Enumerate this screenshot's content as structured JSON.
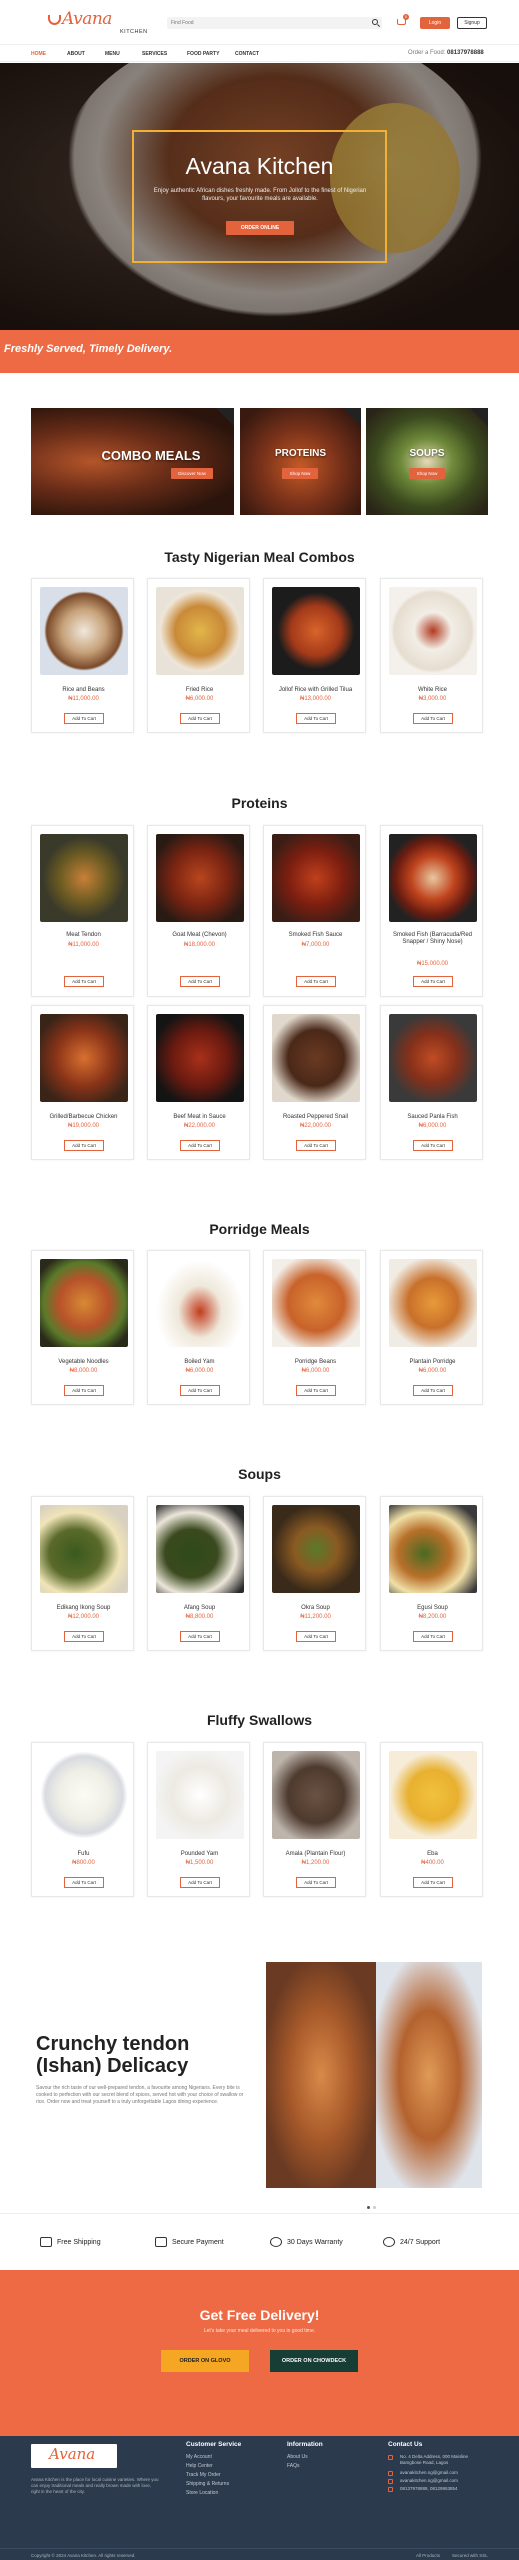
{
  "header": {
    "logo_text": "Avana",
    "logo_sub": "KITCHEN",
    "search_placeholder": "Find Food",
    "cart_count": "0",
    "login_label": "Login",
    "signup_label": "Signup"
  },
  "nav": {
    "items": [
      "HOME",
      "ABOUT",
      "MENU",
      "SERVICES",
      "FOOD PARTY",
      "CONTACT"
    ],
    "order_prefix": "Order a Food",
    "order_phone": "08137978888"
  },
  "hero": {
    "title": "Avana Kitchen",
    "tagline": "Enjoy authentic African dishes freshly made. From Jollof to the finest of Nigerian flavours, your favourite meals are available.",
    "cta": "ORDER ONLINE"
  },
  "banner": {
    "text": "Freshly Served, Timely Delivery."
  },
  "categories": [
    {
      "title": "COMBO MEALS",
      "button": "Discover Now"
    },
    {
      "title": "PROTEINS",
      "button": "Shop Now"
    },
    {
      "title": "SOUPS",
      "button": "Shop Now"
    }
  ],
  "add_to_cart_label": "Add To Cart",
  "sections": [
    {
      "title": "Tasty Nigerian Meal Combos",
      "products": [
        {
          "name": "Rice and Beans",
          "price": "₦11,000.00"
        },
        {
          "name": "Fried Rice",
          "price": "₦6,000.00"
        },
        {
          "name": "Jollof Rice with Grilled Tilua",
          "price": "₦13,000.00"
        },
        {
          "name": "White Rice",
          "price": "₦3,000.00"
        }
      ]
    },
    {
      "title": "Proteins",
      "products": [
        {
          "name": "Meat Tendon",
          "price": "₦11,000.00"
        },
        {
          "name": "Goat Meat (Chevon)",
          "price": "₦18,000.00"
        },
        {
          "name": "Smoked Fish Sauce",
          "price": "₦7,000.00"
        },
        {
          "name": "Smoked Fish (Barracuda/Red Snapper / Shiny Nose)",
          "price": "₦15,000.00"
        },
        {
          "name": "Grilled/Barbecue Chicken",
          "price": "₦19,000.00"
        },
        {
          "name": "Beef Meat in Sauce",
          "price": "₦22,000.00"
        },
        {
          "name": "Roasted Peppered Snail",
          "price": "₦22,000.00"
        },
        {
          "name": "Sauced Panla Fish",
          "price": "₦6,000.00"
        }
      ]
    },
    {
      "title": "Porridge Meals",
      "products": [
        {
          "name": "Vegetable Noodles",
          "price": "₦8,000.00"
        },
        {
          "name": "Boiled Yam",
          "price": "₦6,000.00"
        },
        {
          "name": "Porridge Beans",
          "price": "₦6,000.00"
        },
        {
          "name": "Plantain Porridge",
          "price": "₦6,000.00"
        }
      ]
    },
    {
      "title": "Soups",
      "products": [
        {
          "name": "Edikang Ikong Soup",
          "price": "₦12,000.00"
        },
        {
          "name": "Afang Soup",
          "price": "₦8,800.00"
        },
        {
          "name": "Okra Soup",
          "price": "₦11,200.00"
        },
        {
          "name": "Egusi Soup",
          "price": "₦8,200.00"
        }
      ]
    },
    {
      "title": "Fluffy Swallows",
      "products": [
        {
          "name": "Fufu",
          "price": "₦800.00"
        },
        {
          "name": "Pounded Yam",
          "price": "₦1,500.00"
        },
        {
          "name": "Amala (Plantain Flour)",
          "price": "₦1,200.00"
        },
        {
          "name": "Eba",
          "price": "₦400.00"
        }
      ]
    }
  ],
  "promo": {
    "title": "Crunchy tendon (Ishan) Delicacy",
    "text": "Savour the rich taste of our well-prepared tendon, a favourite among Nigerians. Every bite is cooked to perfection with our secret blend of spices, served hot with your choice of swallow or rice. Order now and treat yourself to a truly unforgettable Lagos dining experience."
  },
  "features": [
    "Free Shipping",
    "Secure Payment",
    "30 Days Warranty",
    "24/7 Support"
  ],
  "delivery": {
    "title": "Get Free Delivery!",
    "text": "Let's take your meal delivered to you in good time.",
    "btn1": "ORDER ON GLOVO",
    "btn2": "ORDER ON CHOWDECK"
  },
  "footer": {
    "logo_text": "Avana",
    "about": "Avana Kitchen is the place for local cuisine varieties. Where you can enjoy traditional meals and really brown made with love, right in the heart of the city.",
    "col1_title": "Customer Service",
    "col1_links": [
      "My Account",
      "Help Center",
      "Track My Order",
      "Shipping & Returns",
      "Store Location"
    ],
    "col2_title": "Information",
    "col2_links": [
      "About Us",
      "FAQs"
    ],
    "col3_title": "Contact Us",
    "contacts": [
      "No. 4 Delta Address, 000 Mainline Bamgbose Road, Lagos",
      "avanakitchen.ng@gmail.com",
      "avanakitchen.ng@gmail.com",
      "08137978888, 08129953854"
    ],
    "copyright": "Copyright © 2024 Avana Kitchen. All rights reserved.",
    "bottom_links": [
      "All Products",
      "Secured with SSL"
    ]
  }
}
